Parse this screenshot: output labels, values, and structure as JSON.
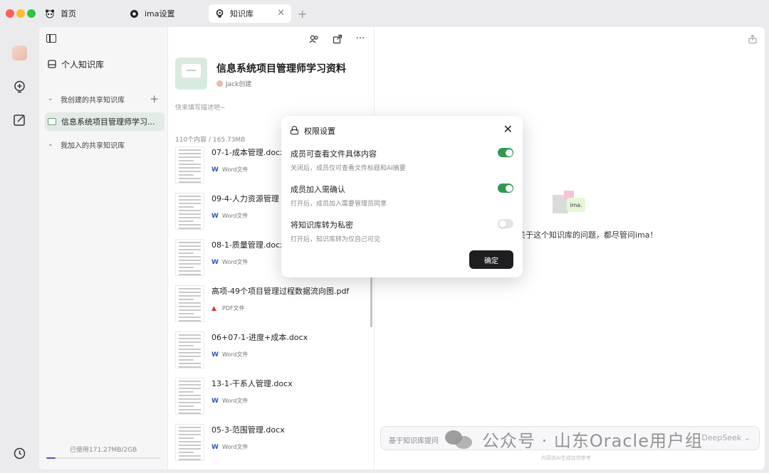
{
  "tabs": [
    {
      "label": "首页",
      "icon": "panda-icon"
    },
    {
      "label": "ima设置",
      "icon": "ima-gear-icon"
    },
    {
      "label": "知识库",
      "icon": "knowledge-base-icon",
      "active": true
    }
  ],
  "sidebar": {
    "personal_kb": "个人知识库",
    "created_shared": "我创建的共享知识库",
    "selected_kb": "信息系统项目管理师学习...",
    "joined_shared": "我加入的共享知识库",
    "storage": "已使用171.27MB/2GB",
    "storage_fraction": 0.084
  },
  "kb": {
    "title": "信息系统项目管理师学习资料",
    "author": "Jack创建",
    "desc_placeholder": "快来填写描述吧~",
    "count": "110个内容 / 165.73MB"
  },
  "files": [
    {
      "name": "07-1-成本管理.docx",
      "type": "Word文件",
      "kind": "word"
    },
    {
      "name": "09-4-人力资源管理",
      "type": "Word文件",
      "kind": "word"
    },
    {
      "name": "08-1-质量管理.docx",
      "type": "Word文件",
      "kind": "word"
    },
    {
      "name": "高项-49个项目管理过程数据流向图.pdf",
      "type": "PDF文件",
      "kind": "pdf"
    },
    {
      "name": "06+07-1-进度+成本.docx",
      "type": "Word文件",
      "kind": "word"
    },
    {
      "name": "13-1-干系人管理.docx",
      "type": "Word文件",
      "kind": "word"
    },
    {
      "name": "05-3-范围管理.docx",
      "type": "Word文件",
      "kind": "word"
    }
  ],
  "right": {
    "hero_badge": "ima.",
    "hero_text": "关于这个知识库的问题，都尽管问ima！",
    "ask_placeholder": "基于知识库提问",
    "model": "DeepSeek",
    "disclaimer": "内容由AI生成仅供参考"
  },
  "watermark": "公众号 · 山东Oracle用户组",
  "modal": {
    "title": "权限设置",
    "options": [
      {
        "title": "成员可查看文件具体内容",
        "desc": "关闭后，成员仅可查看文件标题和AI摘要",
        "on": true
      },
      {
        "title": "成员加入需确认",
        "desc": "打开后，成员加入需要管理员同意",
        "on": true
      },
      {
        "title": "将知识库转为私密",
        "desc": "打开后，知识库转为仅自己可见",
        "on": false
      }
    ],
    "confirm": "确定"
  },
  "colors": {
    "accent_green": "#2f9a4e",
    "selected_row": "#e3ebe6",
    "storage_purple": "#6d3fe0",
    "word_blue": "#2b59c3",
    "pdf_red": "#e0352b"
  }
}
